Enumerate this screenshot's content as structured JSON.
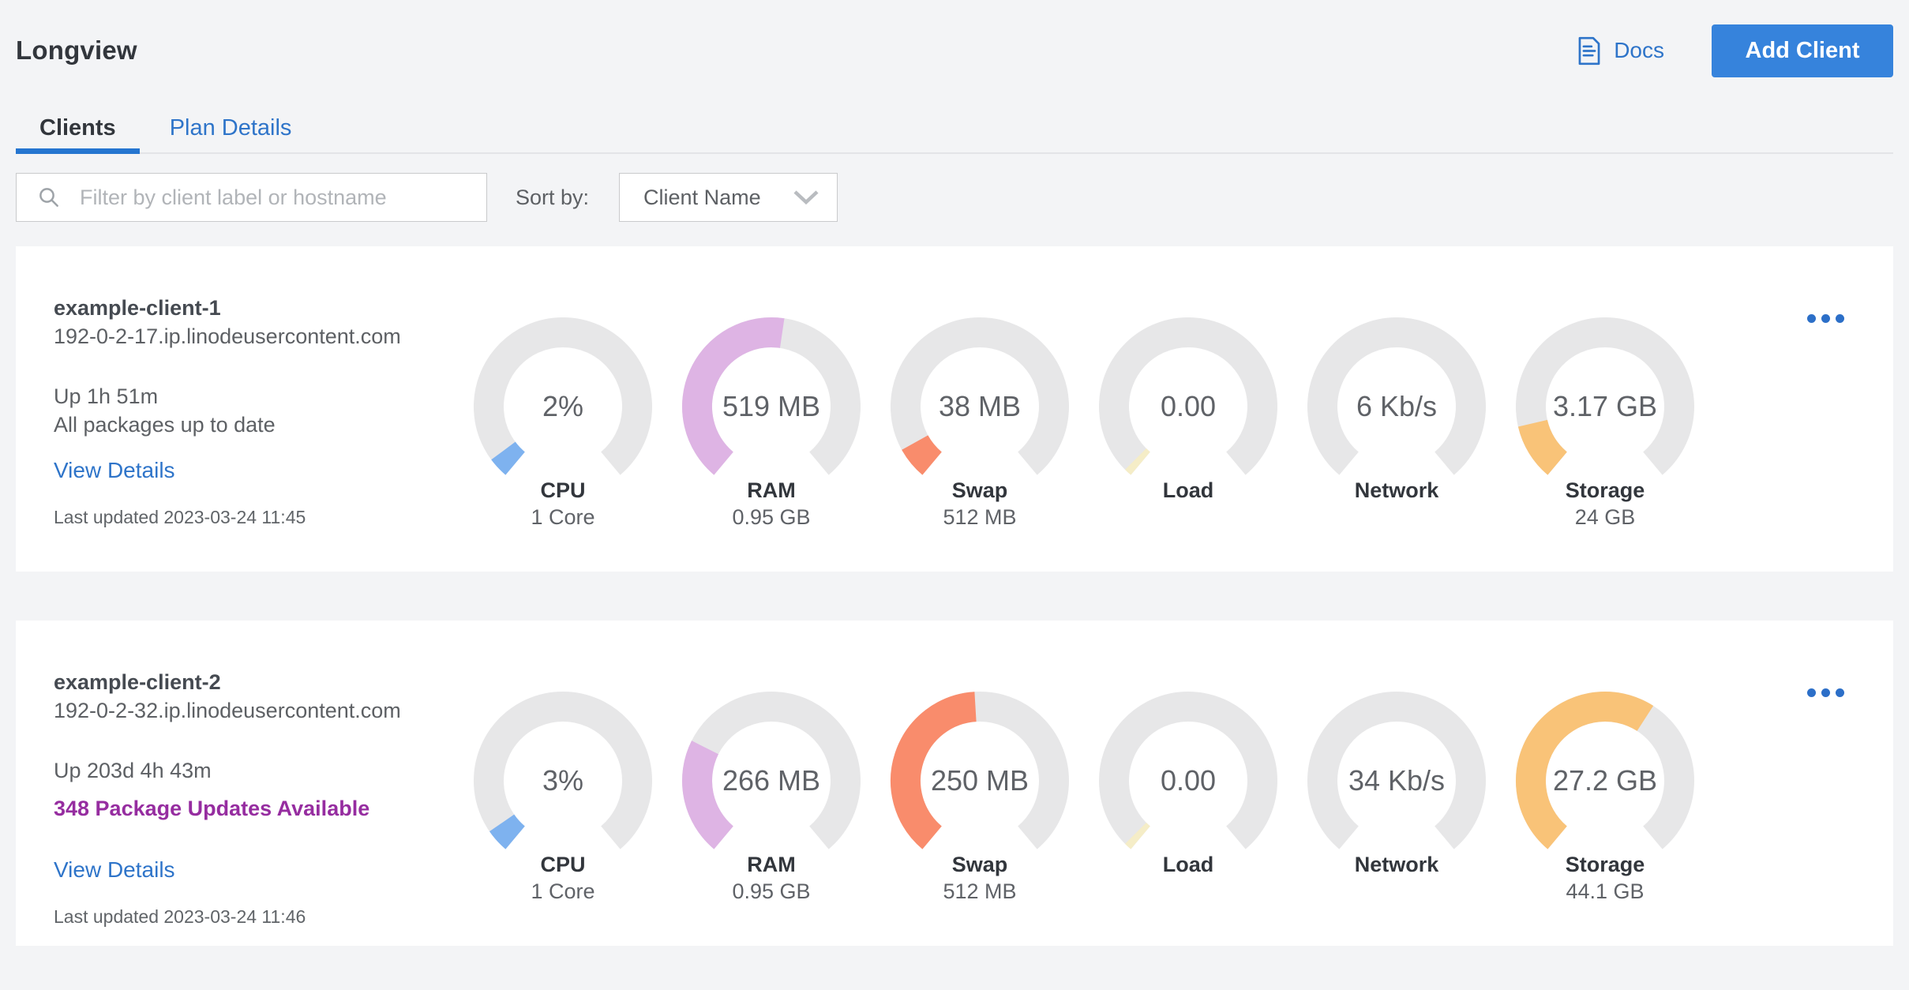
{
  "page": {
    "title": "Longview",
    "background": "#f3f4f6"
  },
  "header": {
    "docs_label": "Docs",
    "add_client_label": "Add Client",
    "button_color": "#3683dc"
  },
  "tabs": [
    {
      "label": "Clients",
      "active": true
    },
    {
      "label": "Plan Details",
      "active": false
    }
  ],
  "toolbar": {
    "search_placeholder": "Filter by client label or hostname",
    "sort_label": "Sort by:",
    "sort_value": "Client Name"
  },
  "colors": {
    "link_blue": "#2e74c9",
    "active_tab_indicator": "#2575d0",
    "package_alert_purple": "#962da0",
    "gauge_track": "#e7e7e8"
  },
  "clients": [
    {
      "name": "example-client-1",
      "hostname": "192-0-2-17.ip.linodeusercontent.com",
      "uptime": "Up 1h 51m",
      "package_status": "All packages up to date",
      "package_alert": false,
      "view_details_label": "View Details",
      "last_updated": "Last updated 2023-03-24 11:45",
      "gauges": [
        {
          "metric": "CPU",
          "value": "2%",
          "sublabel": "1 Core",
          "fill_color": "#7eb2ef",
          "fill_fraction": 0.048
        },
        {
          "metric": "RAM",
          "value": "519 MB",
          "sublabel": "0.95 GB",
          "fill_color": "#deb4e4",
          "fill_fraction": 0.53
        },
        {
          "metric": "Swap",
          "value": "38 MB",
          "sublabel": "512 MB",
          "fill_color": "#f98c6c",
          "fill_fraction": 0.075
        },
        {
          "metric": "Load",
          "value": "0.00",
          "sublabel": "",
          "fill_color": "#f5edc7",
          "fill_fraction": 0.018
        },
        {
          "metric": "Network",
          "value": "6 Kb/s",
          "sublabel": "",
          "fill_color": null,
          "fill_fraction": 0
        },
        {
          "metric": "Storage",
          "value": "3.17 GB",
          "sublabel": "24 GB",
          "fill_color": "#f9c378",
          "fill_fraction": 0.132
        }
      ]
    },
    {
      "name": "example-client-2",
      "hostname": "192-0-2-32.ip.linodeusercontent.com",
      "uptime": "Up 203d 4h 43m",
      "package_status": "348 Package Updates Available",
      "package_alert": true,
      "view_details_label": "View Details",
      "last_updated": "Last updated 2023-03-24 11:46",
      "gauges": [
        {
          "metric": "CPU",
          "value": "3%",
          "sublabel": "1 Core",
          "fill_color": "#7eb2ef",
          "fill_fraction": 0.055
        },
        {
          "metric": "RAM",
          "value": "266 MB",
          "sublabel": "0.95 GB",
          "fill_color": "#deb4e4",
          "fill_fraction": 0.274
        },
        {
          "metric": "Swap",
          "value": "250 MB",
          "sublabel": "512 MB",
          "fill_color": "#f98c6c",
          "fill_fraction": 0.488
        },
        {
          "metric": "Load",
          "value": "0.00",
          "sublabel": "",
          "fill_color": "#f5edc7",
          "fill_fraction": 0.018
        },
        {
          "metric": "Network",
          "value": "34 Kb/s",
          "sublabel": "",
          "fill_color": null,
          "fill_fraction": 0
        },
        {
          "metric": "Storage",
          "value": "27.2 GB",
          "sublabel": "44.1 GB",
          "fill_color": "#f9c378",
          "fill_fraction": 0.617
        }
      ]
    }
  ]
}
